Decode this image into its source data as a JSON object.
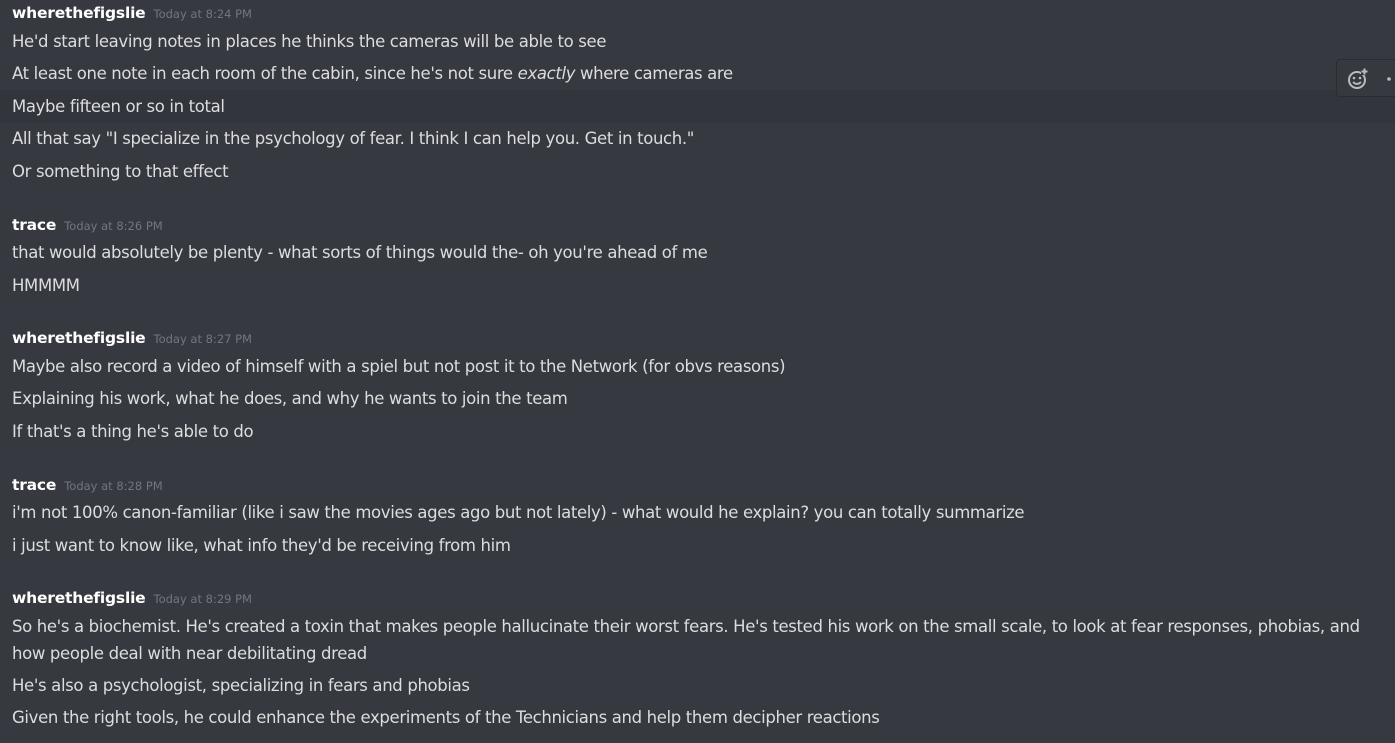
{
  "groups": [
    {
      "username": "wherethefigslie",
      "timestamp": "Today at 8:24 PM",
      "messages": [
        "He'd start leaving notes in places he thinks the cameras will be able to see",
        {
          "before": "At least one note in each room of the cabin, since he's not sure ",
          "italic": "exactly",
          "after": " where cameras are"
        },
        "Maybe fifteen or so in total",
        "All that say \"I specialize in the psychology of fear. I think I can help you. Get in touch.\"",
        "Or something to that effect"
      ]
    },
    {
      "username": "trace",
      "timestamp": "Today at 8:26 PM",
      "messages": [
        "that would absolutely be plenty - what sorts of things would the- oh you're ahead of me",
        "HMMMM"
      ]
    },
    {
      "username": "wherethefigslie",
      "timestamp": "Today at 8:27 PM",
      "messages": [
        "Maybe also record a video of himself with a spiel but not post it to the Network (for obvs reasons)",
        "Explaining his work, what he does, and why he wants to join the team",
        "If that's a thing he's able to do"
      ]
    },
    {
      "username": "trace",
      "timestamp": "Today at 8:28 PM",
      "messages": [
        "i'm not 100% canon-familiar (like i saw the movies ages ago but not lately) - what would he explain? you can totally summarize",
        "i just want to know like, what info they'd be receiving from him"
      ]
    },
    {
      "username": "wherethefigslie",
      "timestamp": "Today at 8:29 PM",
      "messages": [
        "So he's a biochemist. He's created a toxin that makes people hallucinate their worst fears. He's tested his work on the small scale, to look at fear responses, phobias, and how people deal with near debilitating dread",
        "He's also a psychologist, specializing in fears and phobias",
        "Given the right tools, he could enhance the experiments of the Technicians and help them decipher reactions"
      ]
    }
  ],
  "toolbar": {
    "icons": [
      "add-reaction-icon",
      "more-options-icon"
    ]
  },
  "colors": {
    "background": "#36393f",
    "hover_background": "#32353b",
    "username": "#ffffff",
    "message_text": "#dcddde",
    "timestamp": "#72767d"
  }
}
